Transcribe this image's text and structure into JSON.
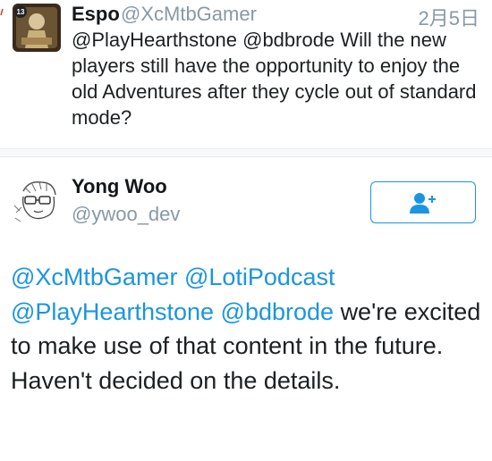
{
  "tweet_top": {
    "name": "Espo",
    "handle": "@XcMtbGamer",
    "date": "2月5日",
    "mentions": [
      "@PlayHearthstone",
      "@bdbrode"
    ],
    "text": "Will the new players still have the opportunity to enjoy the old Adventures after they cycle out of standard mode?"
  },
  "tweet_main": {
    "name": "Yong Woo",
    "handle": "@ywoo_dev",
    "mentions_line1": [
      "@XcMtbGamer",
      "@LotiPodcast"
    ],
    "mentions_line2": [
      "@PlayHearthstone",
      "@bdbrode"
    ],
    "text": "we're excited to make use of that content in the future. Haven't decided on the details."
  },
  "icons": {
    "follow": "add-user-icon"
  },
  "colors": {
    "link": "#1b95e0",
    "muted": "#8899a6",
    "text": "#1c2022"
  }
}
